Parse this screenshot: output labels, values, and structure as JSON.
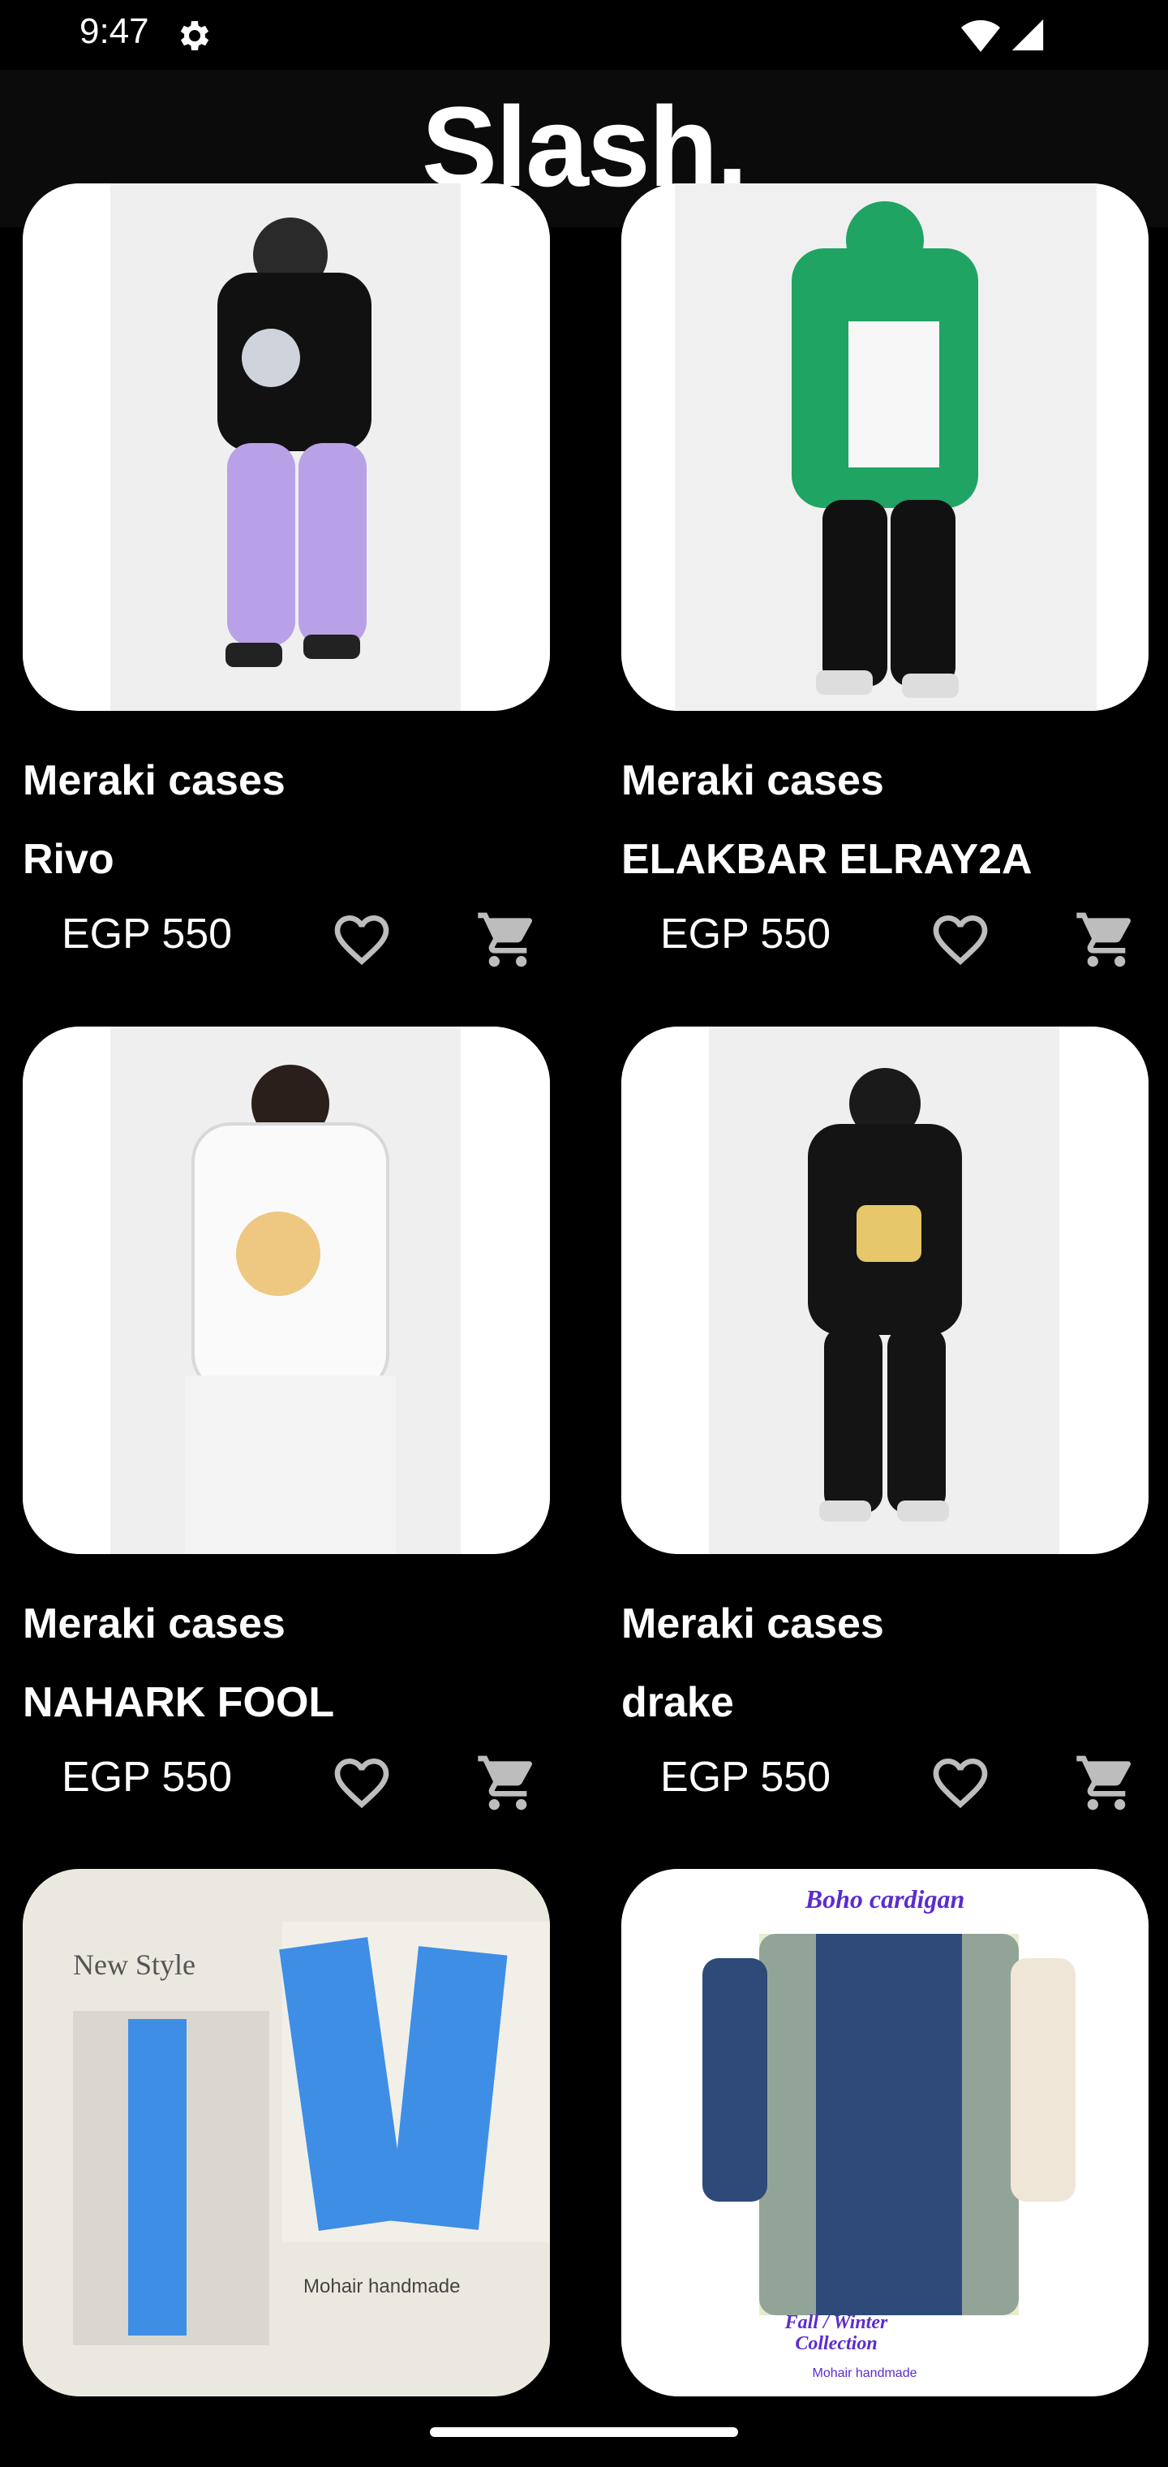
{
  "status_bar": {
    "time": "9:47",
    "icons": [
      "settings-icon",
      "wifi-icon",
      "signal-icon"
    ]
  },
  "app_bar": {
    "title": "Slash."
  },
  "products": [
    {
      "brand": "Meraki cases",
      "name": "Rivo",
      "price": "EGP 550"
    },
    {
      "brand": "Meraki cases",
      "name": "ELAKBAR ELRAY2A",
      "price": "EGP 550"
    },
    {
      "brand": "Meraki cases",
      "name": "NAHARK FOOL",
      "price": "EGP 550"
    },
    {
      "brand": "Meraki cases",
      "name": "drake",
      "price": "EGP 550"
    },
    {
      "brand": "",
      "name": "",
      "price": "",
      "image_text": [
        "New Style",
        "Mohair handmade"
      ]
    },
    {
      "brand": "",
      "name": "",
      "price": "",
      "image_text": [
        "Boho cardigan",
        "Fall / Winter",
        "Collection",
        "Mohair handmade"
      ]
    }
  ],
  "colors": {
    "background": "#000000",
    "app_bar": "#0b0b0b",
    "text": "#ffffff",
    "icon": "#bdbdbd"
  }
}
